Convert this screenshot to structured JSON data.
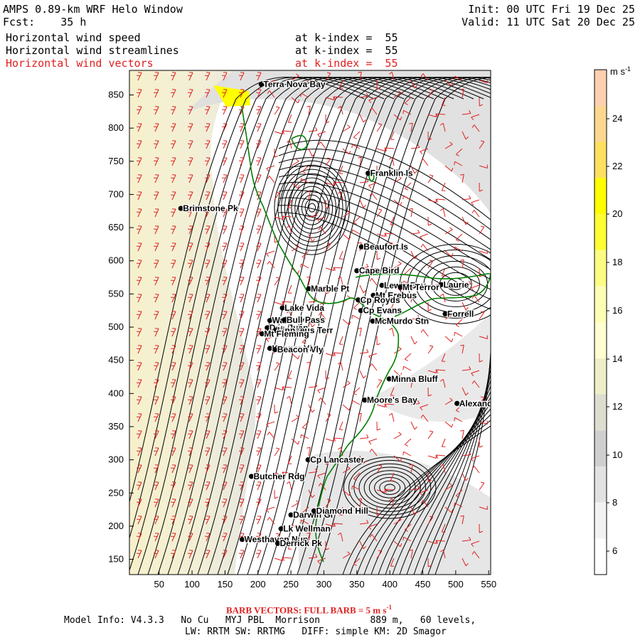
{
  "header": {
    "title": "AMPS 0.89-km WRF Helo Window",
    "fcst": "Fcst:    35 h",
    "init": "Init: 00 UTC Fri 19 Dec 25",
    "valid": "Valid: 11 UTC Sat 20 Dec 25",
    "fields": [
      {
        "name": "Horizontal wind speed",
        "level": "at k-index =  55"
      },
      {
        "name": "Horizontal wind streamlines",
        "level": "at k-index =  55"
      },
      {
        "name": "Horizontal wind vectors",
        "level": "at k-index =  55"
      }
    ]
  },
  "map": {
    "x_ticks": [
      "50",
      "100",
      "150",
      "200",
      "250",
      "300",
      "350",
      "400",
      "450",
      "500",
      "550"
    ],
    "y_ticks": [
      "150",
      "200",
      "250",
      "300",
      "350",
      "400",
      "450",
      "500",
      "550",
      "600",
      "650",
      "700",
      "750",
      "800",
      "850"
    ],
    "x_range": [
      5,
      553
    ],
    "y_range": [
      127,
      887
    ],
    "sites": [
      {
        "name": "Terra Nova Bay",
        "x": 205,
        "y": 866
      },
      {
        "name": "Franklin Is",
        "x": 367,
        "y": 732
      },
      {
        "name": "Brimstone Pk",
        "x": 83,
        "y": 679
      },
      {
        "name": "Beaufort Is",
        "x": 357,
        "y": 621
      },
      {
        "name": "Cape Bird",
        "x": 350,
        "y": 585
      },
      {
        "name": "Lewis Bay",
        "x": 388,
        "y": 563
      },
      {
        "name": "Laurie",
        "x": 478,
        "y": 564
      },
      {
        "name": "Mt Terror",
        "x": 416,
        "y": 560
      },
      {
        "name": "Marble Pt",
        "x": 277,
        "y": 558
      },
      {
        "name": "Mt Erebus",
        "x": 375,
        "y": 548
      },
      {
        "name": "Cp Royds",
        "x": 352,
        "y": 541
      },
      {
        "name": "Lake Vida",
        "x": 237,
        "y": 529
      },
      {
        "name": "Cp Evans",
        "x": 356,
        "y": 525
      },
      {
        "name": "Forrell",
        "x": 484,
        "y": 520
      },
      {
        "name": "Wall Vly",
        "x": 218,
        "y": 510
      },
      {
        "name": "Bull Pass",
        "x": 240,
        "y": 511
      },
      {
        "name": "McMurdo Stn",
        "x": 374,
        "y": 509
      },
      {
        "name": "Don Juan",
        "x": 214,
        "y": 499
      },
      {
        "name": "Linnaeus Terr",
        "x": 226,
        "y": 495
      },
      {
        "name": "Mt Fleming",
        "x": 206,
        "y": 490
      },
      {
        "name": "Kennar Vly",
        "x": 218,
        "y": 468
      },
      {
        "name": "Beacon Vly",
        "x": 226,
        "y": 466
      },
      {
        "name": "Minna Bluff",
        "x": 399,
        "y": 422
      },
      {
        "name": "Moore's Bay",
        "x": 362,
        "y": 390
      },
      {
        "name": "Alexander",
        "x": 502,
        "y": 385
      },
      {
        "name": "Cp Lancaster",
        "x": 276,
        "y": 300
      },
      {
        "name": "Butcher Rdg",
        "x": 190,
        "y": 275
      },
      {
        "name": "Darwin Gl",
        "x": 250,
        "y": 217
      },
      {
        "name": "Diamond Hill",
        "x": 285,
        "y": 223
      },
      {
        "name": "Lk Wellman",
        "x": 235,
        "y": 196
      },
      {
        "name": "Westhaven Nun",
        "x": 176,
        "y": 180
      },
      {
        "name": "Derrick Pk",
        "x": 230,
        "y": 174
      }
    ]
  },
  "colorbar": {
    "unit": "m s",
    "unit_exp": "-1",
    "ticks": [
      "24",
      "22",
      "20",
      "18",
      "16",
      "14",
      "12",
      "10",
      "8",
      "6"
    ],
    "colors": [
      "#ffffff",
      "#f3f3f3",
      "#e2e2e2",
      "#cfcfcf",
      "#ddddd0",
      "#eeeec8",
      "#fefed0",
      "#fdfdb4",
      "#fcfc84",
      "#fefe33",
      "#fefe00",
      "#fde060",
      "#fdd790",
      "#fdd0b0"
    ]
  },
  "footer": {
    "barb_note": "BARB VECTORS: FULL BARB = 5 m s",
    "barb_exp": "-1",
    "line1": "Model Info: V4.3.3   No Cu   MYJ PBL  Morrison         889 m,   60 levels,",
    "line2": "LW: RRTM SW: RRTMG   DIFF: simple KM: 2D Smagor"
  },
  "colors": {
    "coast": "#008000",
    "barb": "#e02020",
    "stream": "#000000"
  }
}
